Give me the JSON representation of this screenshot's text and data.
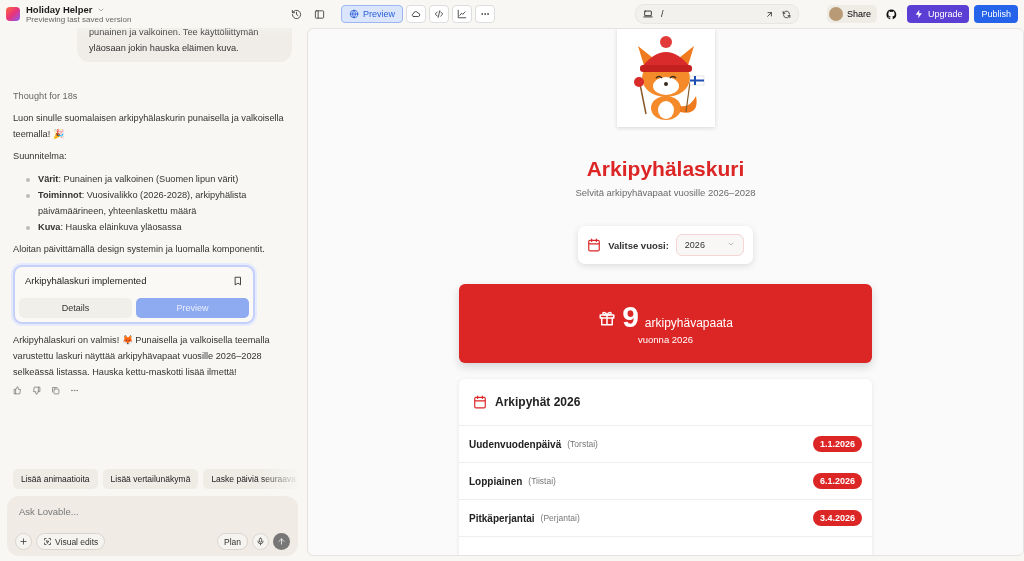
{
  "app": {
    "title": "Holiday Helper",
    "subtitle": "Previewing last saved version"
  },
  "toolbar": {
    "tabs": [
      {
        "label": "Preview",
        "selected": true
      }
    ],
    "path": "/",
    "share": "Share",
    "upgrade": "Upgrade",
    "publish": "Publish"
  },
  "chat": {
    "user_message": "punainen ja valkoinen. Tee käyttöliittymän yläosaan jokin hauska eläimen kuva.",
    "thought": "Thought for 18s",
    "intro": "Luon sinulle suomalaisen arkipyhälaskurin punaisella ja valkoisella teemalla! 🎉",
    "plan_heading": "Suunnitelma:",
    "plan_items": [
      {
        "text": "**Värit**: Punainen ja valkoinen (Suomen lipun värit)"
      },
      {
        "text": "**Toiminnot**: Vuosivalikko (2026-2028), arkipyhälista päivämäärineen, yhteenlaskettu määrä"
      },
      {
        "text": "**Kuva**: Hauska eläinkuva yläosassa"
      }
    ],
    "closing": "Aloitan päivittämällä design systemin ja luomalla komponentit.",
    "artifact": {
      "title": "Arkipyhälaskuri implemented",
      "buttons": [
        {
          "label": "Details",
          "selected": false
        },
        {
          "label": "Preview",
          "selected": true
        }
      ]
    },
    "summary": "Arkipyhälaskuri on valmis! 🦊 Punaisella ja valkoisella teemalla varustettu laskuri näyttää arkipyhävapaat vuosille 2026–2028 selkeässä listassa. Hauska kettu-maskotti lisää ilmettä!",
    "suggestions": [
      "Lisää animaatioita",
      "Lisää vertailunäkymä",
      "Laske päiviä seuraava"
    ],
    "composer": {
      "placeholder": "Ask Lovable...",
      "visual_edits": "Visual edits",
      "plan": "Plan"
    }
  },
  "preview": {
    "title": "Arkipyhälaskuri",
    "subtitle": "Selvitä arkipyhävapaat vuosille 2026–2028",
    "year_label": "Valitse vuosi:",
    "year_value": "2026",
    "count": "9",
    "count_label": "arkipyhävapaata",
    "count_sub": "vuonna 2026",
    "list_title": "Arkipyhät 2026",
    "holidays": [
      {
        "name": "Uudenvuodenpäivä",
        "weekday": "(Torstai)",
        "date": "1.1.2026"
      },
      {
        "name": "Loppiainen",
        "weekday": "(Tiistai)",
        "date": "6.1.2026"
      },
      {
        "name": "Pitkäperjantai",
        "weekday": "(Perjantai)",
        "date": "3.4.2026"
      }
    ]
  }
}
